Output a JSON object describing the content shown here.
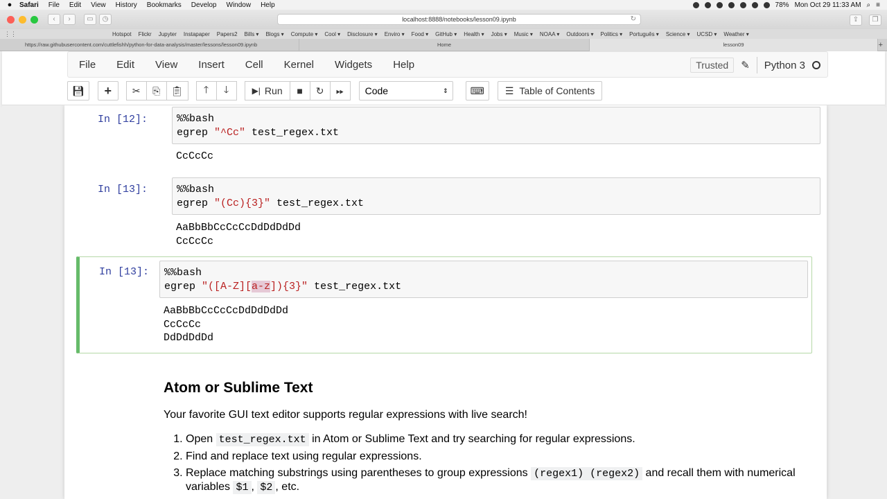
{
  "menubar": {
    "app": "Safari",
    "items": [
      "File",
      "Edit",
      "View",
      "History",
      "Bookmarks",
      "Develop",
      "Window",
      "Help"
    ],
    "battery": "78%",
    "clock": "Mon Oct 29  11:33 AM"
  },
  "browser": {
    "url": "localhost:8888/notebooks/lesson09.ipynb",
    "bookmarks": [
      "Hotspot",
      "Flickr",
      "Jupyter",
      "Instapaper",
      "Papers2",
      "Bills ▾",
      "Blogs ▾",
      "Compute ▾",
      "Cool ▾",
      "Disclosure ▾",
      "Enviro ▾",
      "Food ▾",
      "GitHub ▾",
      "Health ▾",
      "Jobs ▾",
      "Music ▾",
      "NOAA ▾",
      "Outdoors ▾",
      "Politics ▾",
      "Português ▾",
      "Science ▾",
      "UCSD ▾",
      "Weather ▾"
    ],
    "tabs": [
      "https://raw.githubusercontent.com/cuttlefishh/python-for-data-analysis/master/lessons/lesson09.ipynb",
      "Home",
      "lesson09"
    ]
  },
  "jupyter": {
    "menu": [
      "File",
      "Edit",
      "View",
      "Insert",
      "Cell",
      "Kernel",
      "Widgets",
      "Help"
    ],
    "trusted": "Trusted",
    "kernel": "Python 3",
    "run_label": "Run",
    "cell_type": "Code",
    "toc_label": "Table of Contents"
  },
  "cells": [
    {
      "prompt": "In [12]:",
      "line1": "%%bash",
      "cmd": "egrep ",
      "pattern": "\"^Cc\"",
      "rest": " test_regex.txt",
      "output": [
        "CcCcCc"
      ]
    },
    {
      "prompt": "In [13]:",
      "line1": "%%bash",
      "cmd": "egrep ",
      "pattern": "\"(Cc){3}\"",
      "rest": " test_regex.txt",
      "output": [
        "AaBbBbCcCcCcDdDdDdDd",
        "CcCcCc"
      ]
    },
    {
      "prompt": "In [13]:",
      "line1": "%%bash",
      "cmd": "egrep ",
      "pattern_a": "\"([A-Z][",
      "pattern_sel": "a-z",
      "pattern_b": "]){3}\"",
      "rest": " test_regex.txt",
      "output": [
        "AaBbBbCcCcCcDdDdDdDd",
        "CcCcCc",
        "DdDdDdDd"
      ]
    }
  ],
  "markdown": {
    "heading": "Atom or Sublime Text",
    "intro": "Your favorite GUI text editor supports regular expressions with live search!",
    "items": [
      {
        "num": "1.",
        "pre": "Open ",
        "code": "test_regex.txt",
        "post": " in Atom or Sublime Text and try searching for regular expressions."
      },
      {
        "num": "2.",
        "text": "Find and replace text using regular expressions."
      },
      {
        "num": "3.",
        "pre": "Replace matching substrings using parentheses to group expressions ",
        "code1": "(regex1) (regex2)",
        "post": " and recall them with numerical variables ",
        "code2": "$1",
        "sep": ", ",
        "code3": "$2",
        "end": ", etc."
      }
    ]
  }
}
